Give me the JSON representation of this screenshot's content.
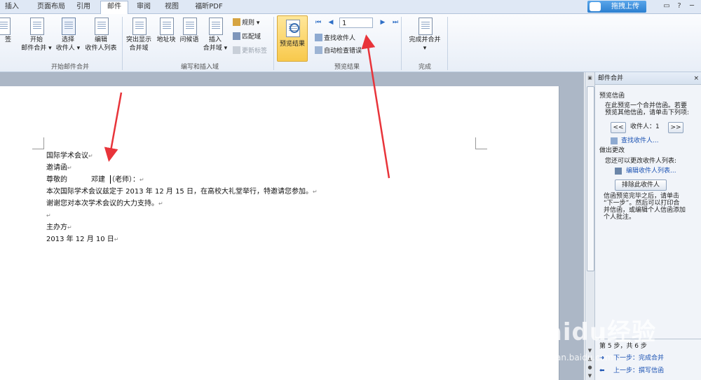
{
  "tabs": [
    {
      "label": "插入",
      "active": false
    },
    {
      "label": "页面布局",
      "active": false
    },
    {
      "label": "引用",
      "active": false
    },
    {
      "label": "邮件",
      "active": true
    },
    {
      "label": "审阅",
      "active": false
    },
    {
      "label": "视图",
      "active": false
    },
    {
      "label": "福昕PDF",
      "active": false
    }
  ],
  "upload_button": "拖拽上传",
  "window_controls": [
    "▭",
    "?",
    "─"
  ],
  "ribbon": {
    "start_merge": {
      "group_label": "开始邮件合并",
      "items": [
        {
          "label1": "签",
          "label2": ""
        },
        {
          "label1": "开始",
          "label2": "邮件合并 ▾"
        },
        {
          "label1": "选择",
          "label2": "收件人 ▾"
        },
        {
          "label1": "编辑",
          "label2": "收件人列表"
        }
      ]
    },
    "write_insert": {
      "group_label": "编写和插入域",
      "items": [
        {
          "label1": "突出显示",
          "label2": "合并域"
        },
        {
          "label1": "地址块",
          "label2": ""
        },
        {
          "label1": "问候语",
          "label2": ""
        },
        {
          "label1": "插入",
          "label2": "合并域 ▾"
        }
      ],
      "small": [
        {
          "label": "规则 ▾",
          "disabled": false
        },
        {
          "label": "匹配域",
          "disabled": false
        },
        {
          "label": "更新标签",
          "disabled": true
        }
      ]
    },
    "preview": {
      "group_label": "预览结果",
      "button": "预览结果",
      "record": "1",
      "nav": [
        "⏮",
        "◀",
        "▶",
        "⏭"
      ],
      "small": [
        {
          "label": "查找收件人"
        },
        {
          "label": "自动检查错误"
        }
      ]
    },
    "finish": {
      "group_label": "完成",
      "button1": "完成并合并",
      "button2": "▾"
    }
  },
  "document": {
    "lines": [
      {
        "text": "国际学术会议",
        "mark": "↵"
      },
      {
        "text": "邀请函",
        "mark": "↵"
      },
      {
        "text": "尊敬的",
        "gap": "",
        "name": "邓建",
        "after": "（老师）：",
        "mark": "↵"
      },
      {
        "text": "本次国际学术会议兹定于 2013 年 12 月 15 日，在高校大礼堂举行，特邀请您参加。",
        "mark": "↵"
      },
      {
        "text": "谢谢您对本次学术会议的大力支持。",
        "mark": "↵"
      },
      {
        "text": "",
        "mark": "↵"
      },
      {
        "text": "主办方",
        "mark": "↵"
      },
      {
        "text": "2013 年 12 月 10 日",
        "mark": "↵"
      }
    ]
  },
  "pane": {
    "title": "邮件合并",
    "close": "×",
    "sec1_heading": "预览信函",
    "sec1_desc1": "在此预览一个合并信函。若要",
    "sec1_desc2": "预览其他信函，请单击下列项:",
    "prev_btn": "<<",
    "recipient_label": "收件人：1",
    "next_btn": ">>",
    "find_recipient": "查找收件人...",
    "sec2_heading": "做出更改",
    "sec2_desc": "您还可以更改收件人列表:",
    "edit_list": "编辑收件人列表...",
    "exclude_btn": "排除此收件人",
    "note1": "信函预览完毕之后，请单击",
    "note2": "“下一步”。然后可以打印合",
    "note3": "并信函，或编辑个人信函添加",
    "note4": "个人批注。",
    "step": "第 5 步，共 6 步",
    "next_step": "下一步：完成合并",
    "prev_step": "上一步：撰写信函"
  },
  "watermark": {
    "main": "Baidu经验",
    "sub": "jingyan.baidu.com"
  },
  "colors": {
    "accent": "#2b7fd0",
    "arrow": "#e8343a",
    "link": "#1b52b3",
    "highlight": "#f8c94c"
  }
}
